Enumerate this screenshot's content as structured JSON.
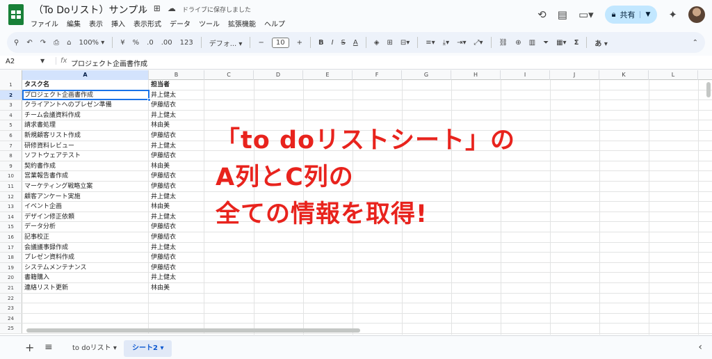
{
  "title_bar": {
    "doc_title": "（To Doリスト）サンプル",
    "save_status": "ドライブに保存しました",
    "share_label": "共有",
    "star_icon": "star-icon",
    "move_icon": "folder-move-icon",
    "cloud_icon": "cloud-done-icon"
  },
  "menu": [
    "ファイル",
    "編集",
    "表示",
    "挿入",
    "表示形式",
    "データ",
    "ツール",
    "拡張機能",
    "ヘルプ"
  ],
  "toolbar": {
    "zoom": "100%",
    "currency": "¥",
    "percent": "%",
    "dec_decrease": ".0",
    "dec_increase": ".00",
    "number_format": "123",
    "font": "デフォ...",
    "font_size": "10",
    "bold": "B",
    "italic": "I",
    "strike": "S",
    "text_color": "A",
    "sigma": "Σ",
    "input_mode": "あ"
  },
  "formula_bar": {
    "name_box": "A2",
    "fx": "fx",
    "content": "プロジェクト企画書作成"
  },
  "columns": [
    "A",
    "B",
    "C",
    "D",
    "E",
    "F",
    "G",
    "H",
    "I",
    "J",
    "K",
    "L"
  ],
  "rows": [
    {
      "n": "1",
      "a": "タスク名",
      "b": "担当者"
    },
    {
      "n": "2",
      "a": "プロジェクト企画書作成",
      "b": "井上健太"
    },
    {
      "n": "3",
      "a": "クライアントへのプレゼン準備",
      "b": "伊藤結衣"
    },
    {
      "n": "4",
      "a": "チーム会議資料作成",
      "b": "井上健太"
    },
    {
      "n": "5",
      "a": "請求書処理",
      "b": "林由美"
    },
    {
      "n": "6",
      "a": "新規顧客リスト作成",
      "b": "伊藤結衣"
    },
    {
      "n": "7",
      "a": "研修資料レビュー",
      "b": "井上健太"
    },
    {
      "n": "8",
      "a": "ソフトウェアテスト",
      "b": "伊藤結衣"
    },
    {
      "n": "9",
      "a": "契約書作成",
      "b": "林由美"
    },
    {
      "n": "10",
      "a": "営業報告書作成",
      "b": "伊藤結衣"
    },
    {
      "n": "11",
      "a": "マーケティング戦略立案",
      "b": "伊藤結衣"
    },
    {
      "n": "12",
      "a": "顧客アンケート実施",
      "b": "井上健太"
    },
    {
      "n": "13",
      "a": "イベント企画",
      "b": "林由美"
    },
    {
      "n": "14",
      "a": "デザイン修正依頼",
      "b": "井上健太"
    },
    {
      "n": "15",
      "a": "データ分析",
      "b": "伊藤結衣"
    },
    {
      "n": "16",
      "a": "記事校正",
      "b": "伊藤結衣"
    },
    {
      "n": "17",
      "a": "会議議事録作成",
      "b": "井上健太"
    },
    {
      "n": "18",
      "a": "プレゼン資料作成",
      "b": "伊藤結衣"
    },
    {
      "n": "19",
      "a": "システムメンテナンス",
      "b": "伊藤結衣"
    },
    {
      "n": "20",
      "a": "書籍購入",
      "b": "井上健太"
    },
    {
      "n": "21",
      "a": "連絡リスト更新",
      "b": "林由美"
    },
    {
      "n": "22",
      "a": "",
      "b": ""
    },
    {
      "n": "23",
      "a": "",
      "b": ""
    },
    {
      "n": "24",
      "a": "",
      "b": ""
    },
    {
      "n": "25",
      "a": "",
      "b": ""
    }
  ],
  "annotation": {
    "line1": "「to  doリストシート」の",
    "line2": "A列とC列の",
    "line3": "全ての情報を取得!"
  },
  "sheet_tabs": [
    {
      "label": "to doリスト",
      "active": false
    },
    {
      "label": "シート2",
      "active": true
    }
  ],
  "colors": {
    "accent": "#1a73e8",
    "annotation": "#e8231d",
    "share_bg": "#c2e7ff",
    "sheets_green": "#188038"
  }
}
